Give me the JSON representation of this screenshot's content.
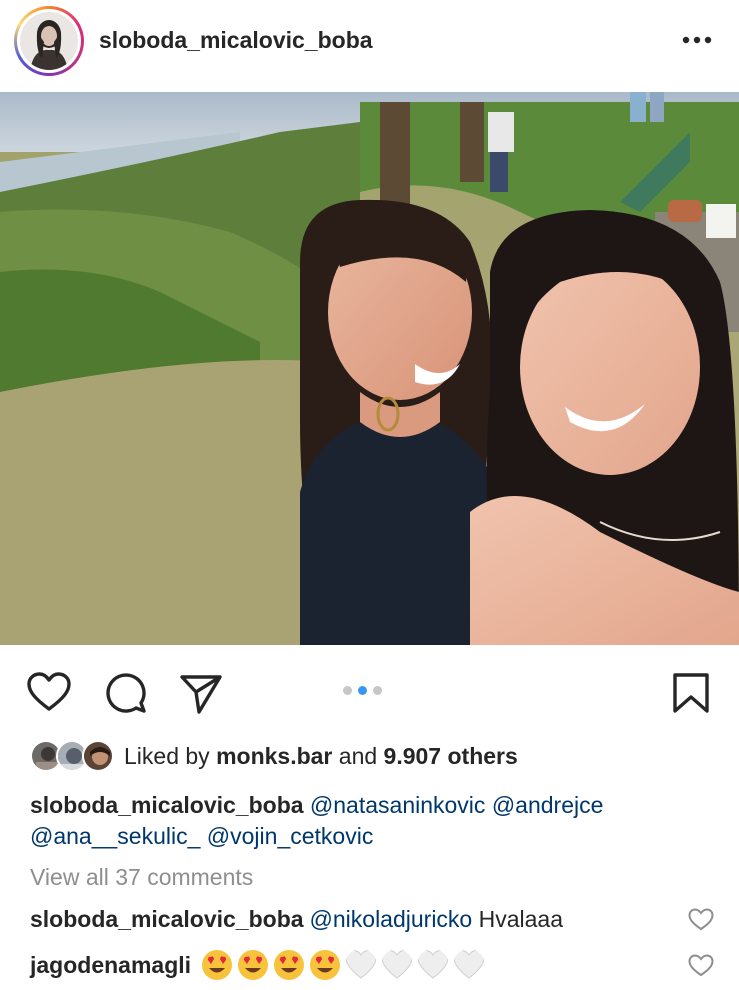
{
  "post": {
    "username": "sloboda_micalovic_boba",
    "more_icon": "more-horizontal-icon"
  },
  "carousel": {
    "count": 3,
    "active_index": 1
  },
  "likes": {
    "prefix": "Liked by ",
    "user": "monks.bar",
    "middle": " and ",
    "count": "9.907 others"
  },
  "caption": {
    "username": "sloboda_micalovic_boba",
    "mentions": [
      "@natasaninkovic",
      "@andrejce",
      "@ana__sekulic_",
      "@vojin_cetkovic"
    ]
  },
  "comments": {
    "view_all": "View all 37 comments",
    "items": [
      {
        "username": "sloboda_micalovic_boba",
        "mention": "@nikoladjuricko",
        "text": " Hvalaaa"
      },
      {
        "username": "jagodenamagli",
        "emoji": [
          "heart-eyes",
          "heart-eyes",
          "heart-eyes",
          "heart-eyes",
          "white-heart",
          "white-heart",
          "white-heart",
          "white-heart"
        ]
      }
    ]
  },
  "colors": {
    "text": "#262626",
    "mention": "#00376b",
    "muted": "#8e8e8e",
    "active_dot": "#3897f0"
  }
}
